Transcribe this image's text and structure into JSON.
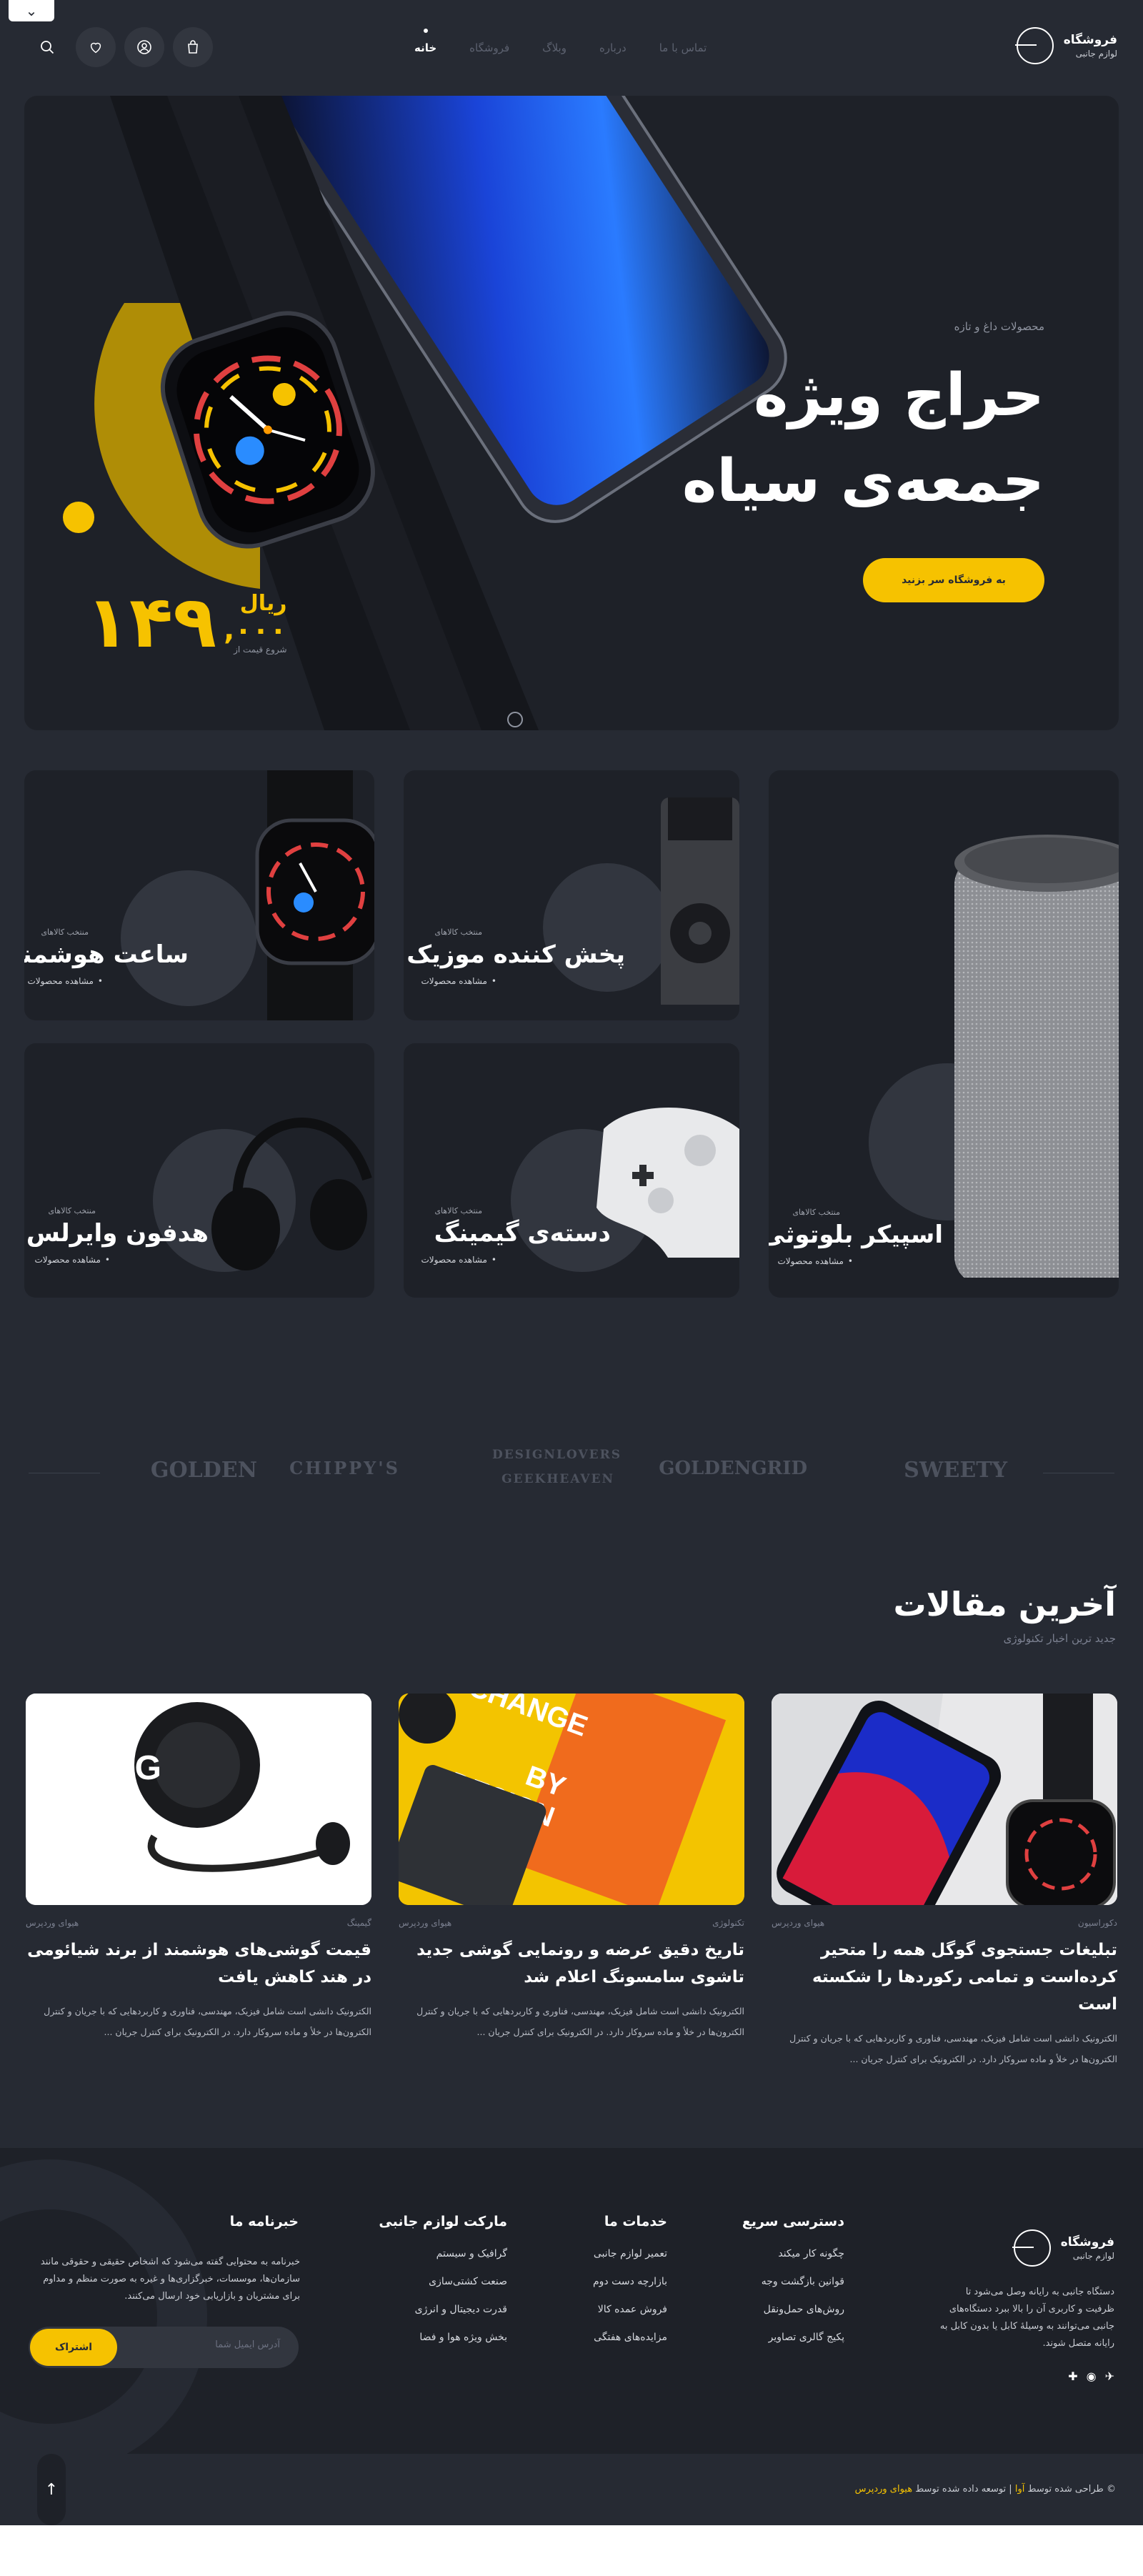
{
  "header": {
    "logo_title": "فروشگاه",
    "logo_subtitle": "لوازم جانبی",
    "nav": [
      "خانه",
      "فروشگاه",
      "وبلاگ",
      "درباره",
      "تماس با ما"
    ]
  },
  "hero": {
    "kicker": "محصولات داغ و تازه",
    "title_line1": "حراج ویژه",
    "title_line2": "جمعه‌ی سیاه",
    "cta": "به فروشگاه سر بزنید",
    "price_number": "۱۴۹",
    "price_decimal": ",۰۰۰",
    "currency": "ریال",
    "price_label": "شروع قیمت از"
  },
  "categories": [
    {
      "kicker": "منتخب کالاهای",
      "title": "اسپیکر بلوتوثی",
      "link": "مشاهده محصولات"
    },
    {
      "kicker": "منتخب کالاهای",
      "title": "پخش کننده موزیک",
      "link": "مشاهده محصولات"
    },
    {
      "kicker": "منتخب کالاهای",
      "title": "ساعت هوشمند",
      "link": "مشاهده محصولات"
    },
    {
      "kicker": "منتخب کالاهای",
      "title": "دسته‌ی گیمینگ",
      "link": "مشاهده محصولات"
    },
    {
      "kicker": "منتخب کالاهای",
      "title": "هدفون وایرلس",
      "link": "مشاهده محصولات"
    }
  ],
  "brands": [
    "SWEETY",
    "GOLDENGRID",
    "DESIGNLOVERS",
    "GEEKHEAVEN",
    "CHIPPY'S",
    "GOLDEN"
  ],
  "articles": {
    "title": "آخرین مقالات",
    "subtitle": "جدید ترین اخبار تکنولوژی",
    "posts": [
      {
        "category": "دکوراسیون",
        "author": "هیوای وردپرس",
        "title": "تبلیغات جستجوی گوگل همه را متحیر کرده‌است و تمامی رکوردها را شکسته است",
        "excerpt": "الکترونیک دانشی است شامل فیزیک، مهندسی، فناوری و کاربردهایی که با جریان و کنترل الکترون‌ها در خلأ و ماده سروکار دارد. در الکترونیک برای کنترل جریان ..."
      },
      {
        "category": "تکنولوژی",
        "author": "هیوای وردپرس",
        "title": "تاریخ دقیق عرضه و رونمایی گوشی جدید تاشوی سامسونگ اعلام شد",
        "excerpt": "الکترونیک دانشی است شامل فیزیک، مهندسی، فناوری و کاربردهایی که با جریان و کنترل الکترون‌ها در خلأ و ماده سروکار دارد. در الکترونیک برای کنترل جریان ..."
      },
      {
        "category": "گیمینگ",
        "author": "هیوای وردپرس",
        "title": "قیمت گوشی‌های هوشمند از برند شیائومی در هند کاهش یافت",
        "excerpt": "الکترونیک دانشی است شامل فیزیک، مهندسی، فناوری و کاربردهایی که با جریان و کنترل الکترون‌ها در خلأ و ماده سروکار دارد. در الکترونیک برای کنترل جریان ..."
      }
    ]
  },
  "footer": {
    "logo_title": "فروشگاه",
    "logo_subtitle": "لوازم جانبی",
    "about": "دستگاه جانبی به رایانه وصل می‌شود تا ظرفیت و کاربری آن را بالا ببرد دستگاه‌های جانبی می‌توانند به وسیلهٔ کابل یا بدون کابل به رایانه متصل شوند.",
    "columns": [
      {
        "title": "دسترسی سریع",
        "items": [
          "چگونه کار میکند",
          "قوانین بازگشت وجه",
          "روش‌های حمل‌ونقل",
          "پکیج گالری تصاویر"
        ]
      },
      {
        "title": "خدمات ما",
        "items": [
          "تعمیر لوازم جانبی",
          "بازارچه دست دوم",
          "فروش عمده کالا",
          "مزایده‌های هفتگی"
        ]
      },
      {
        "title": "مارکت لوازم جانبی",
        "items": [
          "گرافیک و سیستم",
          "صنعت کشتی‌سازی",
          "قدرت دیجیتال و انرژی",
          "بخش ویژه هوا و فضا"
        ]
      }
    ],
    "newsletter_title": "خبرنامه ما",
    "newsletter_text": "خبرنامه به محتوایی گفته می‌شود که اشخاص حقیقی و حقوقی مانند سازمان‌ها، موسسات، خبرگزاری‌ها و غیره به صورت منظم و مداوم برای مشتریان و بازاریابی خود ارسال می‌کنند.",
    "newsletter_placeholder": "آدرس ایمیل شما",
    "newsletter_button": "اشتراک",
    "copyright_prefix": "© طراحی شده توسط",
    "copyright_brand": "آوا",
    "copyright_mid": "| توسعه داده شده توسط",
    "copyright_dev": "هیوای وردپرس"
  },
  "colors": {
    "accent": "#f6c200",
    "bg": "#262a33",
    "card": "#1e2128"
  }
}
